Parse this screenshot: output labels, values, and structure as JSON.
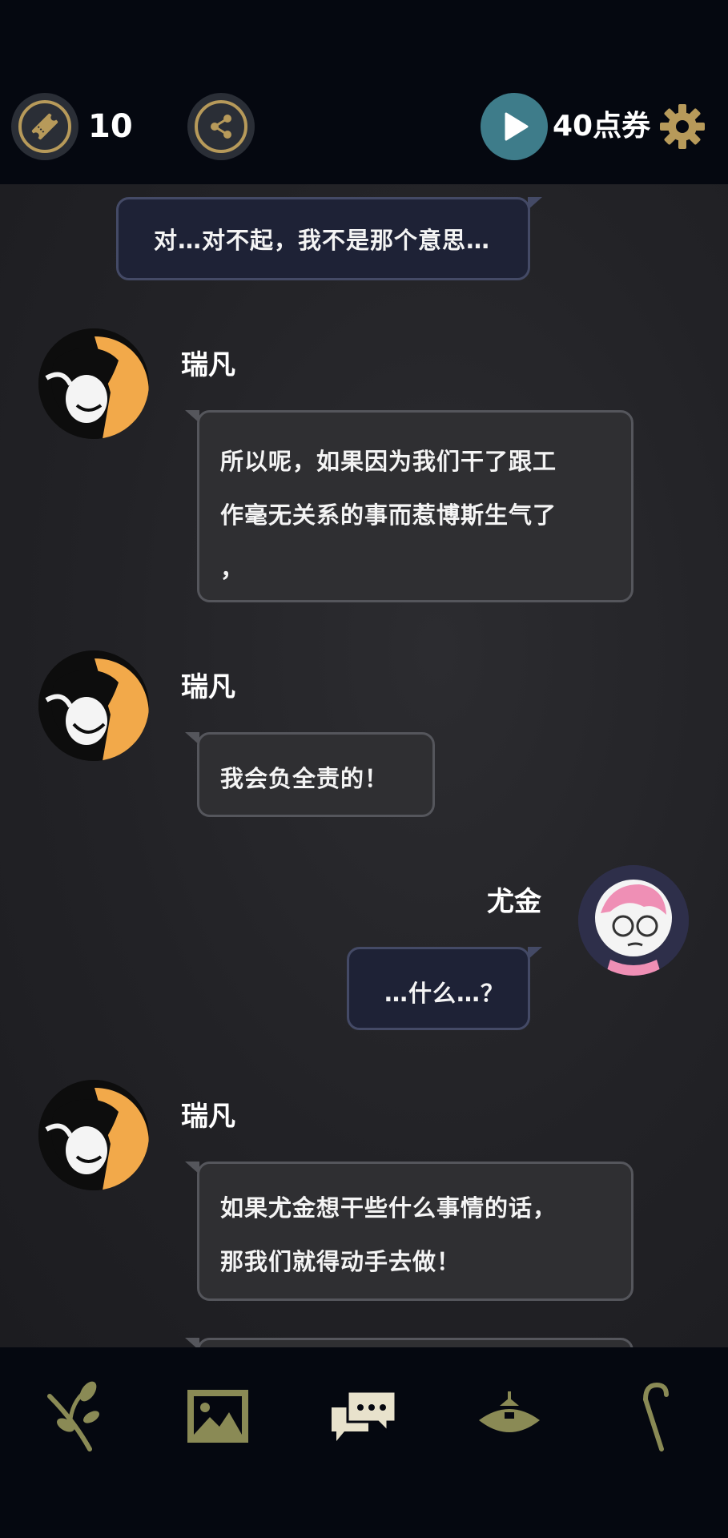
{
  "topbar": {
    "ticket_count": "10",
    "points_label": "40点券"
  },
  "messages": [
    {
      "speaker": "",
      "side": "right",
      "text": "对…对不起，我不是那个意思…"
    },
    {
      "speaker": "瑞凡",
      "side": "left",
      "lines": [
        "所以呢，如果因为我们干了跟工",
        "作毫无关系的事而惹博斯生气了",
        "，"
      ]
    },
    {
      "speaker": "瑞凡",
      "side": "left",
      "text": "我会负全责的！"
    },
    {
      "speaker": "尤金",
      "side": "right",
      "text": "…什么…？"
    },
    {
      "speaker": "瑞凡",
      "side": "left",
      "lines": [
        "如果尤金想干些什么事情的话，",
        "那我们就得动手去做！"
      ]
    }
  ],
  "icons": {
    "ticket": "ticket-icon",
    "share": "share-icon",
    "play": "play-icon",
    "settings": "gear-icon",
    "nav": [
      "branch-icon",
      "gallery-icon",
      "chat-icon",
      "lamp-icon",
      "cane-icon"
    ]
  },
  "colors": {
    "gold": "#b79a5a",
    "play_bg": "#3e7c8a",
    "bubble_left": "#2f2f32",
    "bubble_right": "#1e2236"
  }
}
